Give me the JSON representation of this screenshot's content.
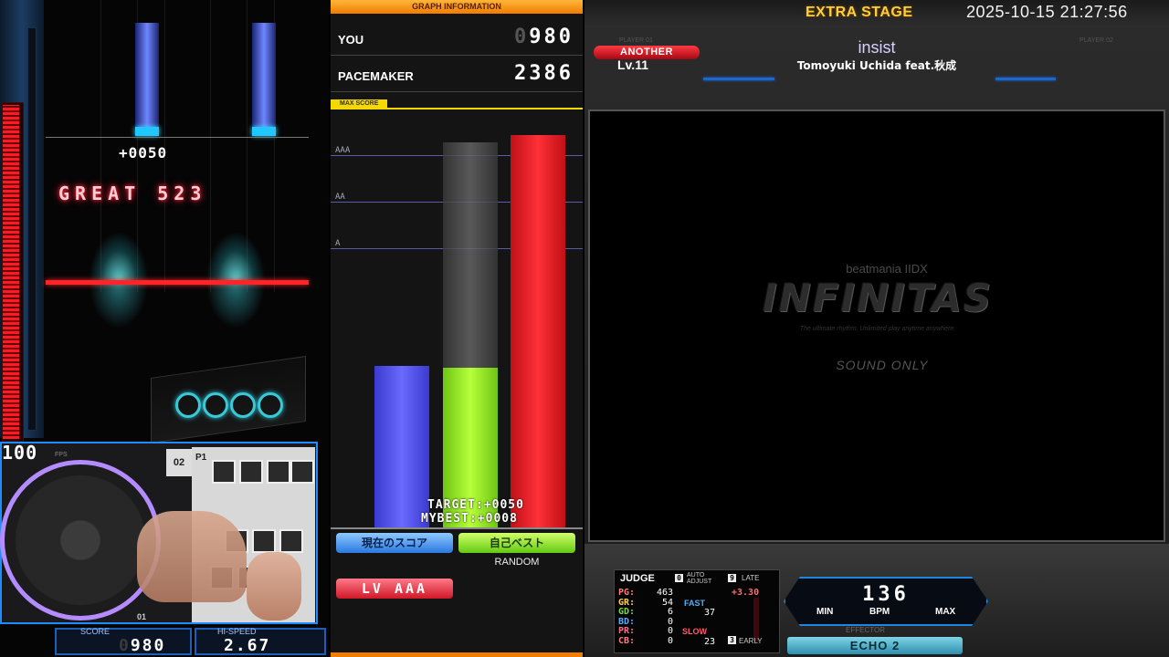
{
  "play": {
    "hud_fast_slow": "+0050",
    "judge_display": "GREAT 523",
    "bpm_readout": "100",
    "bpm_unit": "FPS",
    "score_label": "SCORE",
    "score_value_dim": "0",
    "score_value": "980",
    "hispeed_label": "HI-SPEED",
    "hispeed_value": "2.67",
    "gauge_percent": 100,
    "cam_plate_02": "02",
    "cam_plate_p1": "P1",
    "cam_plate_01": "01"
  },
  "graph": {
    "header": "GRAPH INFORMATION",
    "you_label": "YOU",
    "you_value_dim": "0",
    "you_value": "980",
    "pacemaker_label": "PACEMAKER",
    "pacemaker_value": "2386",
    "maxscore_label": "MAX SCORE",
    "grades": [
      "AAA",
      "AA",
      "A"
    ],
    "target_text": "TARGET:+0050",
    "mybest_text": "MYBEST:+0008",
    "legend_current": "現在のスコア",
    "legend_best": "自己ベスト",
    "option": "RANDOM",
    "pacemaker_mode": "LV AAA"
  },
  "chart_data": {
    "type": "bar",
    "categories": [
      "YOU",
      "MYBEST",
      "PACEMAKER"
    ],
    "values": [
      980,
      972,
      2386
    ],
    "ylim": [
      0,
      2544
    ],
    "colors": [
      "#5a5af5",
      "#a8f02a",
      "#e8202a"
    ]
  },
  "header": {
    "stage": "EXTRA STAGE",
    "datetime": "2025-10-15 21:27:56",
    "player1_tag": "PLAYER 01",
    "player2_tag": "PLAYER 02",
    "difficulty": "ANOTHER",
    "level": "Lv.11",
    "song_title": "insist",
    "artist": "Tomoyuki Uchida feat.秋成"
  },
  "bga": {
    "logo_top": "beatmania IIDX",
    "logo_main": "INFINITAS",
    "logo_sub": "The ultimate rhythm. Unlimited play anytime anywhere.",
    "sound_only": "SOUND ONLY"
  },
  "judge": {
    "title": "JUDGE",
    "auto_adjust_key": "0",
    "auto_adjust": "AUTO ADJUST",
    "late_key": "9",
    "late": "LATE",
    "early_key": "3",
    "early": "EARLY",
    "fast_label": "FAST",
    "slow_label": "SLOW",
    "adjust_value": "+3.30",
    "fast_value": "37",
    "slow_value": "23",
    "rows": [
      {
        "label": "PG:",
        "value": "463",
        "color": "#ff7a7a"
      },
      {
        "label": "GR:",
        "value": "54",
        "color": "#ffcc55"
      },
      {
        "label": "GD:",
        "value": "6",
        "color": "#7bd64a"
      },
      {
        "label": "BD:",
        "value": "0",
        "color": "#55aaff"
      },
      {
        "label": "PR:",
        "value": "0",
        "color": "#ff6a8c"
      },
      {
        "label": "CB:",
        "value": "0",
        "color": "#ff7a7a"
      }
    ]
  },
  "bpm": {
    "value": "136",
    "min_label": "MIN",
    "bpm_label": "BPM",
    "max_label": "MAX"
  },
  "effector": {
    "label": "EFFECTOR",
    "value": "ECHO 2"
  }
}
